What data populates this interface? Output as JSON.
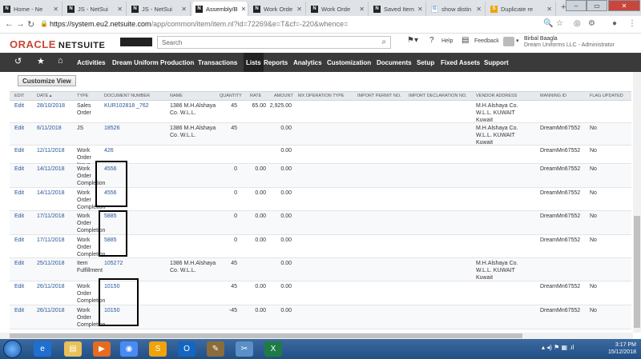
{
  "browser": {
    "tabs": [
      {
        "label": "Home - Ne",
        "icon": "N"
      },
      {
        "label": "JS - NetSui",
        "icon": "N"
      },
      {
        "label": "JS - NetSui",
        "icon": "N"
      },
      {
        "label": "Assembly/B",
        "icon": "N",
        "active": true
      },
      {
        "label": "Work Orde",
        "icon": "N"
      },
      {
        "label": "Work Orde",
        "icon": "N"
      },
      {
        "label": "Saved Item",
        "icon": "N"
      },
      {
        "label": "show distin",
        "icon": "G"
      },
      {
        "label": "Duplicate re",
        "icon": "S"
      }
    ],
    "url_host": "https://system.eu2.netsuite.com",
    "url_path": "/app/common/item/item.nl?id=72269&e=T&cf=-220&whence="
  },
  "header": {
    "brand_oracle": "ORACLE",
    "brand_netsuite": "NETSUITE",
    "search_placeholder": "Search",
    "help": "Help",
    "feedback": "Feedback",
    "user_name": "Birbal Baagla",
    "user_role": "Dream Uniforms LLC - Administrator"
  },
  "menu": [
    "Activities",
    "Dream Uniform Production",
    "Transactions",
    "Lists",
    "Reports",
    "Analytics",
    "Customization",
    "Documents",
    "Setup",
    "Fixed Assets",
    "Support"
  ],
  "customize_label": "Customize View",
  "columns": [
    "Edit",
    "Date ▴",
    "Type",
    "Document Number",
    "Name",
    "Quantity",
    "Rate",
    "Amount",
    "MX Operation Type",
    "Import Permit No.",
    "Import Declaration No.",
    "Vendor Address",
    "Manning ID",
    "Flag Updated"
  ],
  "rows": [
    {
      "edit": "Edit",
      "date": "28/10/2018",
      "type": "Sales Order",
      "doc": "KUR102818 _762",
      "name": "1386 M.H.Alshaya Co. W.L.L.",
      "qty": "45",
      "rate": "65.00",
      "amount": "2,925.00",
      "vendor": "M.H.Alshaya Co. W.L.L. KUWAIT Kuwait",
      "manning": "",
      "flag": ""
    },
    {
      "edit": "Edit",
      "date": "6/11/2018",
      "type": "JS",
      "doc": "18526",
      "name": "1386 M.H.Alshaya Co. W.L.L.",
      "qty": "45",
      "rate": "",
      "amount": "0.00",
      "vendor": "M.H.Alshaya Co. W.L.L. KUWAIT Kuwait",
      "manning": "DreamMn67552",
      "flag": "No"
    },
    {
      "edit": "Edit",
      "date": "12/11/2018",
      "type": "Work Order Issue",
      "doc": "426",
      "name": "",
      "qty": "",
      "rate": "",
      "amount": "0.00",
      "vendor": "",
      "manning": "DreamMn67552",
      "flag": "No"
    },
    {
      "edit": "Edit",
      "date": "14/11/2018",
      "type": "Work Order Completion",
      "doc": "4556",
      "name": "",
      "qty": "0",
      "rate": "0.00",
      "amount": "0.00",
      "vendor": "",
      "manning": "DreamMn67552",
      "flag": "No"
    },
    {
      "edit": "Edit",
      "date": "14/11/2018",
      "type": "Work Order Completion",
      "doc": "4556",
      "name": "",
      "qty": "0",
      "rate": "0.00",
      "amount": "0.00",
      "vendor": "",
      "manning": "DreamMn67552",
      "flag": "No"
    },
    {
      "edit": "Edit",
      "date": "17/11/2018",
      "type": "Work Order Completion",
      "doc": "5885",
      "name": "",
      "qty": "0",
      "rate": "0.00",
      "amount": "0.00",
      "vendor": "",
      "manning": "DreamMn67552",
      "flag": "No"
    },
    {
      "edit": "Edit",
      "date": "17/11/2018",
      "type": "Work Order Completion",
      "doc": "5885",
      "name": "",
      "qty": "0",
      "rate": "0.00",
      "amount": "0.00",
      "vendor": "",
      "manning": "DreamMn67552",
      "flag": "No"
    },
    {
      "edit": "Edit",
      "date": "25/11/2018",
      "type": "Item Fulfillment",
      "doc": "105272",
      "name": "1386 M.H.Alshaya Co. W.L.L.",
      "qty": "45",
      "rate": "",
      "amount": "0.00",
      "vendor": "M.H.Alshaya Co. W.L.L. KUWAIT Kuwait",
      "manning": "",
      "flag": ""
    },
    {
      "edit": "Edit",
      "date": "26/11/2018",
      "type": "Work Order Completion",
      "doc": "10150",
      "name": "",
      "qty": "45",
      "rate": "0.00",
      "amount": "0.00",
      "vendor": "",
      "manning": "DreamMn67552",
      "flag": "No"
    },
    {
      "edit": "Edit",
      "date": "26/11/2018",
      "type": "Work Order Completion",
      "doc": "10150",
      "name": "",
      "qty": "-45",
      "rate": "0.00",
      "amount": "0.00",
      "vendor": "",
      "manning": "DreamMn67552",
      "flag": "No"
    }
  ],
  "taskbar": {
    "time": "3:17 PM",
    "date": "15/12/2018"
  }
}
